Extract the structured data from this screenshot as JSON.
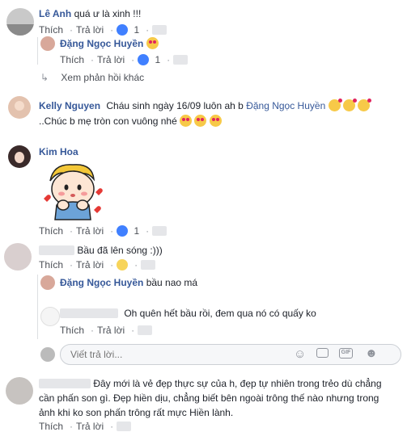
{
  "actions": {
    "like": "Thích",
    "reply": "Trả lời",
    "dot": "·"
  },
  "c1": {
    "name": "Lê Anh",
    "text": "quá ư là xinh !!!",
    "likes": "1"
  },
  "r1": {
    "name": "Đặng Ngọc Huyền"
  },
  "more_replies": "Xem phản hồi khác",
  "c2": {
    "name": "Kelly Nguyen",
    "text": "Cháu sinh ngày 16/09 luôn ah b",
    "mention": "Đặng Ngọc Huyền",
    "text2": "..Chúc b mẹ tròn con vuông nhé"
  },
  "c3": {
    "name": "Kim Hoa",
    "likes": "1"
  },
  "c4": {
    "text": "Bầu đã lên sóng :)))"
  },
  "r2": {
    "name": "Đặng Ngọc Huyền",
    "text": "bầu nao má"
  },
  "r3": {
    "text": "Oh quên hết bầu rồi, đem qua nó có quấy ko"
  },
  "reply_input": {
    "placeholder": "Viết trả lời..."
  },
  "c5": {
    "text1": "Đây mới là vẻ đẹp thực sự của h, đẹp tự nhiên trong trẻo dù chẳng",
    "text2": "cần phấn son gì. Đẹp hiền dịu, chẳng biết bên ngoài trông thế nào nhưng trong",
    "text3": "ảnh khi ko son phấn trông rất mực Hiền lành."
  }
}
